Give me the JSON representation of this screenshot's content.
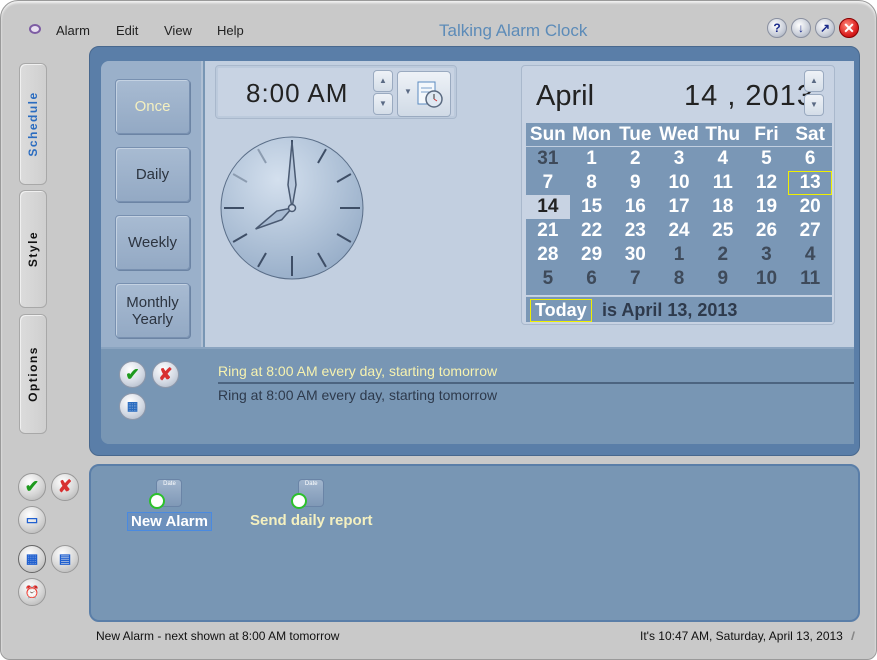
{
  "window": {
    "title": "Talking Alarm Clock"
  },
  "menu": [
    "Alarm",
    "Edit",
    "View",
    "Help"
  ],
  "title_buttons": {
    "help": "?",
    "minimize": "↓",
    "restore": "↗",
    "close": "✕"
  },
  "side_tabs": [
    {
      "label": "Schedule",
      "active": true
    },
    {
      "label": "Style",
      "active": false
    },
    {
      "label": "Options",
      "active": false
    }
  ],
  "schedule_buttons": [
    {
      "label": "Once",
      "active": true
    },
    {
      "label": "Daily",
      "active": false
    },
    {
      "label": "Weekly",
      "active": false
    },
    {
      "label": "Monthly\nYearly",
      "active": false
    }
  ],
  "time": {
    "value": "8:00 AM",
    "hour": 8,
    "minute": 0
  },
  "calendar": {
    "month": "April",
    "date_display": "14 , 2013",
    "weekdays": [
      "Sun",
      "Mon",
      "Tue",
      "Wed",
      "Thu",
      "Fri",
      "Sat"
    ],
    "weeks": [
      [
        "31",
        "1",
        "2",
        "3",
        "4",
        "5",
        "6"
      ],
      [
        "7",
        "8",
        "9",
        "10",
        "11",
        "12",
        "13"
      ],
      [
        "14",
        "15",
        "16",
        "17",
        "18",
        "19",
        "20"
      ],
      [
        "21",
        "22",
        "23",
        "24",
        "25",
        "26",
        "27"
      ],
      [
        "28",
        "29",
        "30",
        "1",
        "2",
        "3",
        "4"
      ],
      [
        "5",
        "6",
        "7",
        "8",
        "9",
        "10",
        "11"
      ]
    ],
    "selected": "14",
    "today": "13",
    "today_button": "Today",
    "today_text": "is April 13, 2013"
  },
  "rules": [
    "Ring at 8:00 AM every day, starting tomorrow",
    "Ring at 8:00 AM every day, starting tomorrow"
  ],
  "alarms": [
    {
      "label": "New Alarm",
      "icon_text": "Date",
      "selected": true
    },
    {
      "label": "Send daily report",
      "icon_text": "Date",
      "selected": false
    }
  ],
  "status": {
    "left": "New Alarm - next shown at 8:00 AM tomorrow",
    "right": "It's 10:47 AM, Saturday, April 13, 2013"
  },
  "colors": {
    "accent": "#2a6cc0",
    "highlight": "#f0f000",
    "panel": "#7896b4"
  }
}
